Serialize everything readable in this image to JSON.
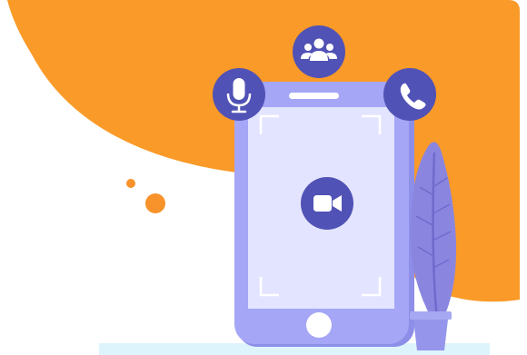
{
  "colors": {
    "background": "#ffffff",
    "orange_blob": "#fa9a28",
    "orange_dot": "#f8922a",
    "phone_body": "#a5a6f6",
    "phone_edge": "#8d8ee8",
    "phone_screen": "#e3e4ff",
    "phone_frame_corners": "#ffffff",
    "circle_button": "#5152b5",
    "icon_foreground": "#ffffff",
    "plant_leaf": "#8a86e0",
    "plant_leaf_vein": "#6f6acb",
    "plant_pot": "#a7a8f2",
    "floor_strip": "#def4fc"
  },
  "icons": {
    "top": "group-users-icon",
    "left": "microphone-icon",
    "right": "phone-call-icon",
    "center": "video-camera-icon"
  }
}
